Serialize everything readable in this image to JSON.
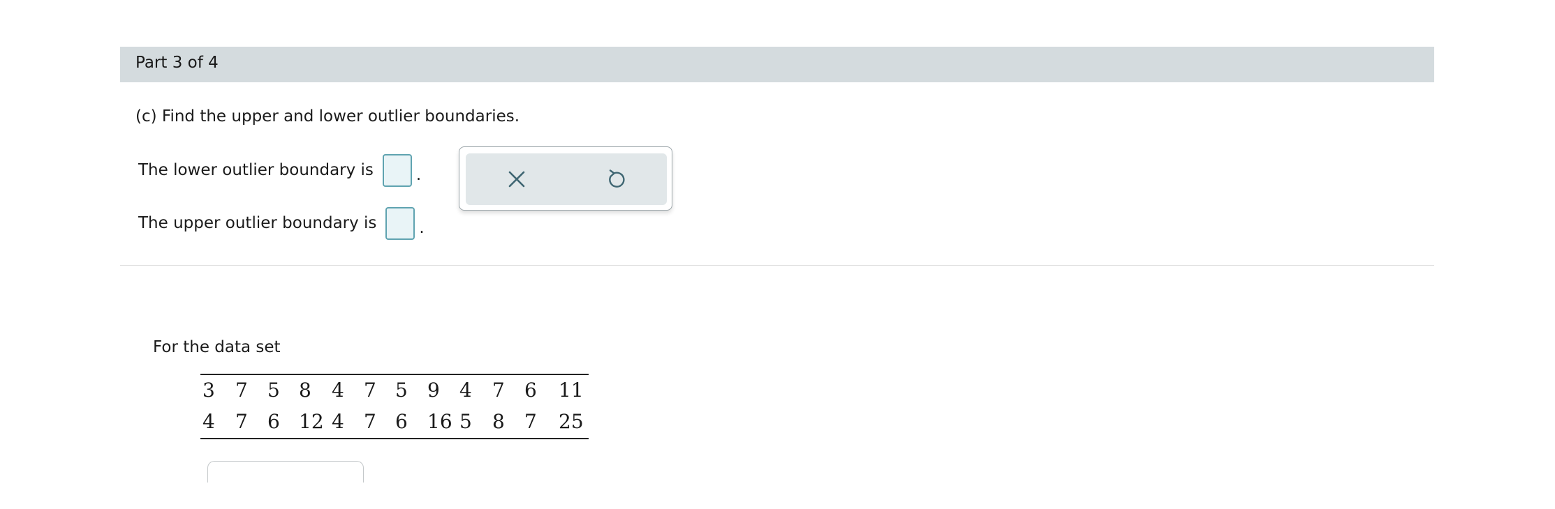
{
  "part_label": "Part 3 of 4",
  "question": "(c) Find the upper and lower outlier boundaries.",
  "answers": {
    "lower_label": "The lower outlier boundary is",
    "lower_value": "",
    "upper_label": "The upper outlier boundary is",
    "upper_value": "",
    "period": "."
  },
  "tools": {
    "clear_icon": "x-icon",
    "undo_icon": "undo-icon"
  },
  "data_intro": "For the data set",
  "data_rows": [
    [
      "3",
      "7",
      "5",
      "8",
      "4",
      "7",
      "5",
      "9",
      "4",
      "7",
      "6",
      "11"
    ],
    [
      "4",
      "7",
      "6",
      "12",
      "4",
      "7",
      "6",
      "16",
      "5",
      "8",
      "7",
      "25"
    ]
  ],
  "colors": {
    "header_bg": "#d4dbde",
    "input_border": "#5fa3b0",
    "input_fill": "#e9f4f7",
    "icon_color": "#3f6672"
  }
}
